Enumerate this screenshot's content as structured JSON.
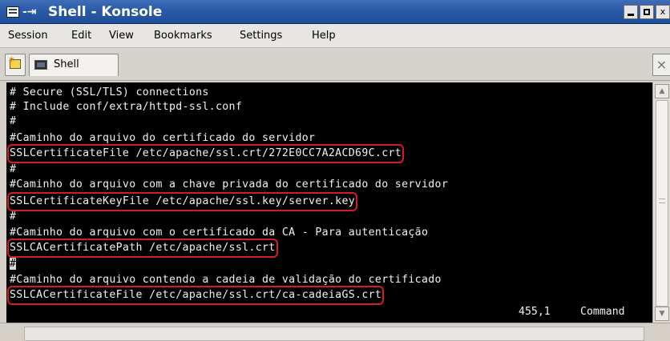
{
  "window": {
    "title": "Shell - Konsole",
    "sticky_glyph": "-⇥",
    "buttons": {
      "minimize_label": "",
      "maximize_label": "",
      "close_label": "x"
    }
  },
  "menubar": {
    "items": [
      "Session",
      "Edit",
      "View",
      "Bookmarks",
      "Settings",
      "Help"
    ]
  },
  "toolbar": {
    "new_session_icon": "new-session-icon",
    "tabs": [
      {
        "label": "Shell",
        "icon": "terminal-icon",
        "active": true
      }
    ],
    "close_session_icon": "close-session-icon"
  },
  "terminal": {
    "lines": [
      "# Secure (SSL/TLS) connections",
      "# Include conf/extra/httpd-ssl.conf",
      "#",
      "#Caminho do arquivo do certificado do servidor",
      "SSLCertificateFile /etc/apache/ssl.crt/272E0CC7A2ACD69C.crt",
      "#",
      "#Caminho do arquivo com a chave privada do certificado do servidor",
      "SSLCertificateKeyFile /etc/apache/ssl.key/server.key",
      "#",
      "#Caminho do arquivo com o certificado da CA - Para autenticação",
      "SSLCACertificatePath /etc/apache/ssl.crt",
      "#",
      "#Caminho do arquivo contendo a cadeia de validação do certificado",
      "SSLCACertificateFile /etc/apache/ssl.crt/ca-cadeiaGS.crt"
    ],
    "highlighted_lines": [
      4,
      7,
      10,
      13
    ],
    "cursor_line": 11,
    "status_position": "455,1",
    "status_mode": "Command",
    "colors": {
      "background": "#000000",
      "foreground": "#f2f2f2",
      "highlight": "#d51c24"
    }
  },
  "scrollbar": {
    "up_icon": "scroll-up-arrow-icon",
    "down_icon": "scroll-down-arrow-icon"
  }
}
